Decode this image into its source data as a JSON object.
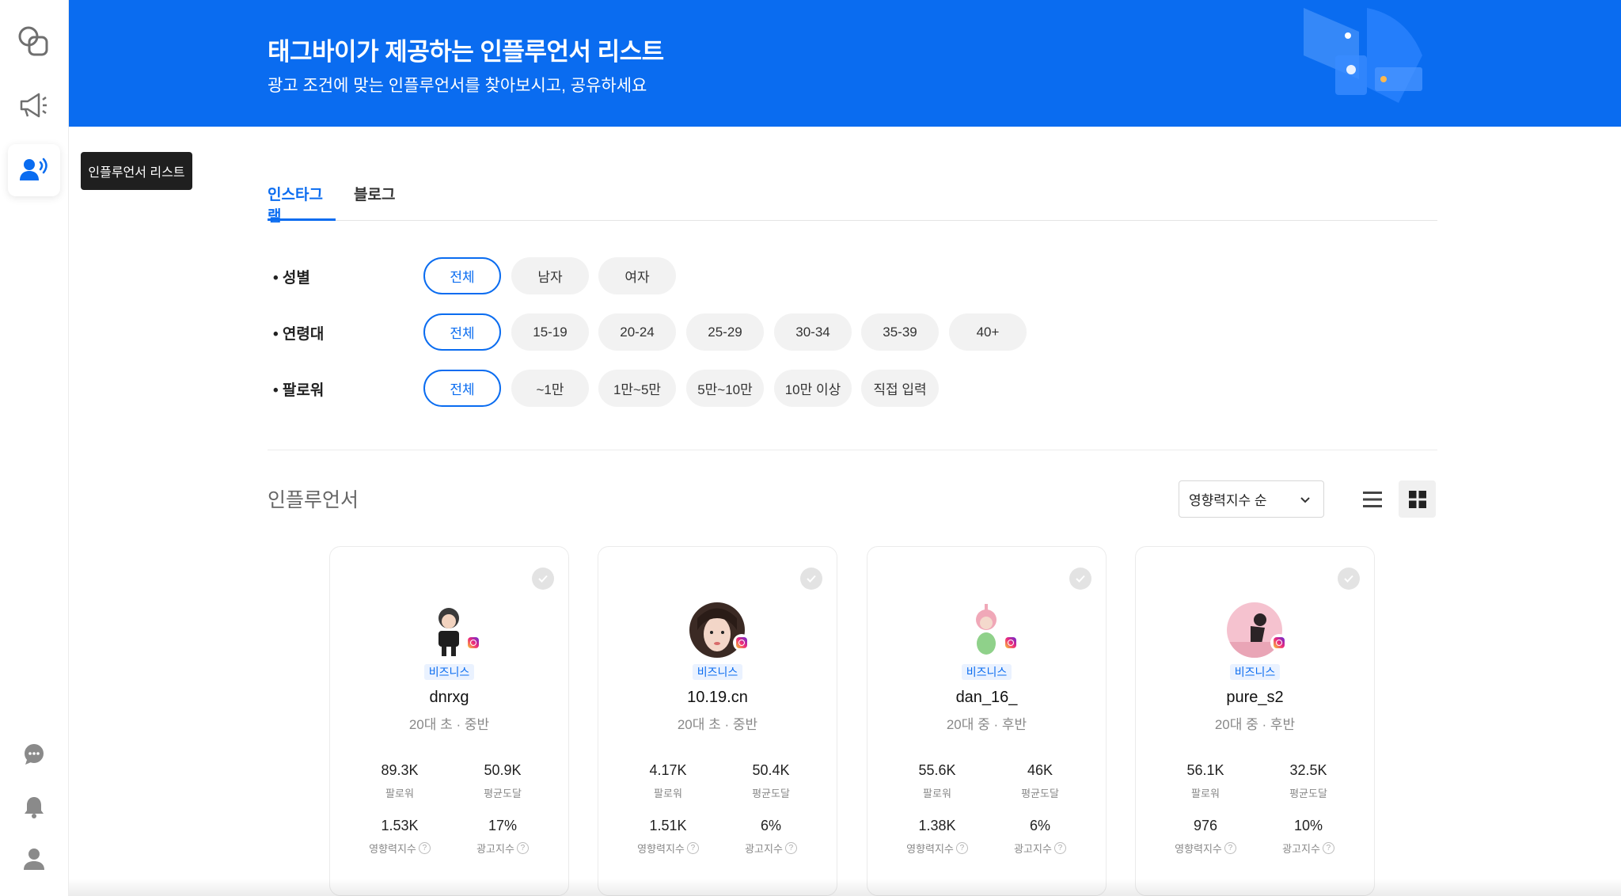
{
  "sidebar": {
    "tooltip": "인플루언서 리스트",
    "icons": [
      "logo-icon",
      "megaphone-icon",
      "influencer-icon",
      "chat-icon",
      "bell-icon",
      "user-icon"
    ]
  },
  "banner": {
    "title": "태그바이가 제공하는 인플루언서 리스트",
    "subtitle": "광고 조건에 맞는 인플루언서를 찾아보시고, 공유하세요"
  },
  "tabs": [
    {
      "label": "인스타그램",
      "active": true
    },
    {
      "label": "블로그",
      "active": false
    }
  ],
  "filters": {
    "gender": {
      "label": "• 성별",
      "options": [
        "전체",
        "남자",
        "여자"
      ],
      "selected": "전체"
    },
    "age": {
      "label": "• 연령대",
      "options": [
        "전체",
        "15-19",
        "20-24",
        "25-29",
        "30-34",
        "35-39",
        "40+"
      ],
      "selected": "전체"
    },
    "followers": {
      "label": "• 팔로워",
      "options": [
        "전체",
        "~1만",
        "1만~5만",
        "5만~10만",
        "10만 이상",
        "직접 입력"
      ],
      "selected": "전체"
    }
  },
  "list": {
    "title": "인플루언서",
    "sort": "영향력지수 순",
    "view": "grid"
  },
  "stat_labels": {
    "followers": "팔로워",
    "reach": "평균도달",
    "influence": "영향력지수",
    "ad": "광고지수"
  },
  "cards": [
    {
      "badge": "비즈니스",
      "name": "dnrxg",
      "age": "20대 초 · 중반",
      "followers": "89.3K",
      "reach": "50.9K",
      "influence": "1.53K",
      "ad": "17%"
    },
    {
      "badge": "비즈니스",
      "name": "10.19.cn",
      "age": "20대 초 · 중반",
      "followers": "4.17K",
      "reach": "50.4K",
      "influence": "1.51K",
      "ad": "6%"
    },
    {
      "badge": "비즈니스",
      "name": "dan_16_",
      "age": "20대 중 · 후반",
      "followers": "55.6K",
      "reach": "46K",
      "influence": "1.38K",
      "ad": "6%"
    },
    {
      "badge": "비즈니스",
      "name": "pure_s2",
      "age": "20대 중 · 후반",
      "followers": "56.1K",
      "reach": "32.5K",
      "influence": "976",
      "ad": "10%"
    }
  ],
  "colors": {
    "brand": "#0a6cf0",
    "pill": "#f2f2f2"
  }
}
